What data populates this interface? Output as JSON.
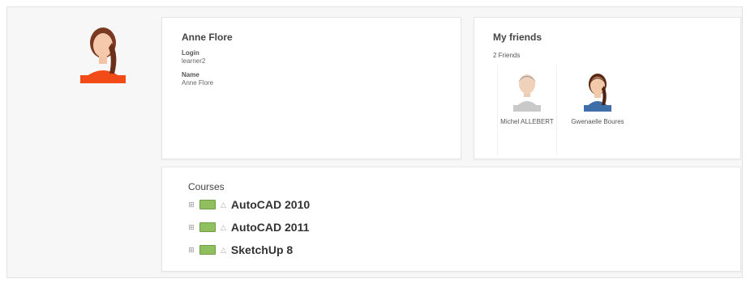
{
  "profile": {
    "name": "Anne Flore",
    "login_label": "Login",
    "login_value": "learner2",
    "name_label": "Name",
    "name_value": "Anne Flore"
  },
  "friends": {
    "title": "My friends",
    "count": "2 Friends",
    "items": [
      {
        "name": "Michel ALLEBERT"
      },
      {
        "name": "Gwenaelle Boures"
      }
    ]
  },
  "courses": {
    "title": "Courses",
    "items": [
      {
        "expand": "⊞",
        "title": "AutoCAD 2010"
      },
      {
        "expand": "⊞",
        "title": "AutoCAD 2011"
      },
      {
        "expand": "⊞",
        "title": "SketchUp 8"
      }
    ]
  }
}
